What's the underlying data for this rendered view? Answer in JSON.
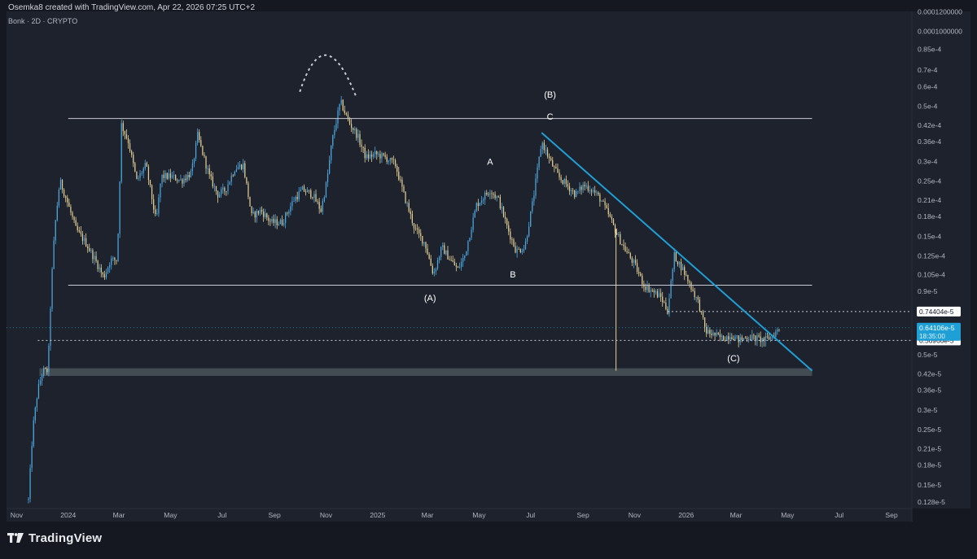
{
  "header": {
    "attribution": "Osemka8 created with TradingView.com, Apr 22, 2026 07:25 UTC+2",
    "symbol": "Bonk · 2D · CRYPTO"
  },
  "brand": {
    "name": "TradingView",
    "icon": "tradingview-logo-icon"
  },
  "colors": {
    "background": "#151821",
    "chart_bg": "#1e222d",
    "up": "#4da8e0",
    "down": "#e3cf94",
    "trendline": "#1e9fd6",
    "channel": "#c9ccd4",
    "zone": "#4a535a",
    "price_badge": "#1e9fd6"
  },
  "chart_data": {
    "type": "candlestick",
    "y_scale": "log",
    "ylim": [
      1.2e-06,
      0.00012
    ],
    "x_range": [
      "2023-10-20",
      "2026-09-25"
    ],
    "x_ticks": [
      {
        "date": "2023-11-01",
        "label": "Nov"
      },
      {
        "date": "2024-01-01",
        "label": "2024"
      },
      {
        "date": "2024-03-01",
        "label": "Mar"
      },
      {
        "date": "2024-05-01",
        "label": "May"
      },
      {
        "date": "2024-07-01",
        "label": "Jul"
      },
      {
        "date": "2024-09-01",
        "label": "Sep"
      },
      {
        "date": "2024-11-01",
        "label": "Nov"
      },
      {
        "date": "2025-01-01",
        "label": "2025"
      },
      {
        "date": "2025-03-01",
        "label": "Mar"
      },
      {
        "date": "2025-05-01",
        "label": "May"
      },
      {
        "date": "2025-07-01",
        "label": "Jul"
      },
      {
        "date": "2025-09-01",
        "label": "Sep"
      },
      {
        "date": "2025-11-01",
        "label": "Nov"
      },
      {
        "date": "2026-01-01",
        "label": "2026"
      },
      {
        "date": "2026-03-01",
        "label": "Mar"
      },
      {
        "date": "2026-05-01",
        "label": "May"
      },
      {
        "date": "2026-07-01",
        "label": "Jul"
      },
      {
        "date": "2026-09-01",
        "label": "Sep"
      }
    ],
    "y_ticks": [
      {
        "value": 0.00012,
        "label": "0.0001200000"
      },
      {
        "value": 0.0001,
        "label": "0.0001000000"
      },
      {
        "value": 8.5e-05,
        "label": "0.85e-4"
      },
      {
        "value": 7e-05,
        "label": "0.7e-4"
      },
      {
        "value": 6e-05,
        "label": "0.6e-4"
      },
      {
        "value": 5e-05,
        "label": "0.5e-4"
      },
      {
        "value": 4.2e-05,
        "label": "0.42e-4"
      },
      {
        "value": 3.6e-05,
        "label": "0.36e-4"
      },
      {
        "value": 3e-05,
        "label": "0.3e-4"
      },
      {
        "value": 2.5e-05,
        "label": "0.25e-4"
      },
      {
        "value": 2.1e-05,
        "label": "0.21e-4"
      },
      {
        "value": 1.8e-05,
        "label": "0.18e-4"
      },
      {
        "value": 1.5e-05,
        "label": "0.15e-4"
      },
      {
        "value": 1.25e-05,
        "label": "0.125e-4"
      },
      {
        "value": 1.05e-05,
        "label": "0.105e-4"
      },
      {
        "value": 9e-06,
        "label": "0.9e-5"
      },
      {
        "value": 5e-06,
        "label": "0.5e-5"
      },
      {
        "value": 4.2e-06,
        "label": "0.42e-5"
      },
      {
        "value": 3.6e-06,
        "label": "0.36e-5"
      },
      {
        "value": 3e-06,
        "label": "0.3e-5"
      },
      {
        "value": 2.5e-06,
        "label": "0.25e-5"
      },
      {
        "value": 2.1e-06,
        "label": "0.21e-5"
      },
      {
        "value": 1.8e-06,
        "label": "0.18e-5"
      },
      {
        "value": 1.5e-06,
        "label": "0.15e-5"
      },
      {
        "value": 1.28e-06,
        "label": "0.128e-5"
      }
    ],
    "price_path": [
      [
        "2023-11-15",
        1.3e-06
      ],
      [
        "2023-11-20",
        2.5e-06
      ],
      [
        "2023-11-26",
        3.6e-06
      ],
      [
        "2023-12-02",
        4.3e-06
      ],
      [
        "2023-12-08",
        4.3e-06
      ],
      [
        "2023-12-12",
        9.5e-06
      ],
      [
        "2023-12-16",
        1.6e-05
      ],
      [
        "2023-12-22",
        2.5e-05
      ],
      [
        "2023-12-30",
        2.1e-05
      ],
      [
        "2024-01-10",
        1.6e-05
      ],
      [
        "2024-01-22",
        1.4e-05
      ],
      [
        "2024-02-02",
        1.2e-05
      ],
      [
        "2024-02-12",
        1.02e-05
      ],
      [
        "2024-02-20",
        1.2e-05
      ],
      [
        "2024-02-28",
        1.2e-05
      ],
      [
        "2024-03-04",
        4.2e-05
      ],
      [
        "2024-03-12",
        3.6e-05
      ],
      [
        "2024-03-22",
        2.5e-05
      ],
      [
        "2024-04-02",
        2.9e-05
      ],
      [
        "2024-04-14",
        1.7e-05
      ],
      [
        "2024-04-20",
        2.6e-05
      ],
      [
        "2024-05-02",
        2.6e-05
      ],
      [
        "2024-05-14",
        2.5e-05
      ],
      [
        "2024-05-26",
        2.7e-05
      ],
      [
        "2024-06-02",
        3.8e-05
      ],
      [
        "2024-06-16",
        2.6e-05
      ],
      [
        "2024-06-26",
        2.2e-05
      ],
      [
        "2024-07-05",
        2.3e-05
      ],
      [
        "2024-07-16",
        2.8e-05
      ],
      [
        "2024-07-26",
        2.9e-05
      ],
      [
        "2024-08-05",
        1.8e-05
      ],
      [
        "2024-08-16",
        1.9e-05
      ],
      [
        "2024-08-28",
        1.7e-05
      ],
      [
        "2024-09-10",
        1.7e-05
      ],
      [
        "2024-09-24",
        2.1e-05
      ],
      [
        "2024-10-04",
        2.3e-05
      ],
      [
        "2024-10-16",
        2.2e-05
      ],
      [
        "2024-10-26",
        1.9e-05
      ],
      [
        "2024-11-02",
        2.5e-05
      ],
      [
        "2024-11-08",
        3.6e-05
      ],
      [
        "2024-11-18",
        5.2e-05
      ],
      [
        "2024-11-28",
        4.3e-05
      ],
      [
        "2024-12-08",
        3.8e-05
      ],
      [
        "2024-12-18",
        3.1e-05
      ],
      [
        "2024-12-30",
        3.2e-05
      ],
      [
        "2025-01-10",
        3.1e-05
      ],
      [
        "2025-01-22",
        2.9e-05
      ],
      [
        "2025-02-01",
        2.2e-05
      ],
      [
        "2025-02-14",
        1.6e-05
      ],
      [
        "2025-02-26",
        1.4e-05
      ],
      [
        "2025-03-08",
        1.05e-05
      ],
      [
        "2025-03-18",
        1.35e-05
      ],
      [
        "2025-03-28",
        1.2e-05
      ],
      [
        "2025-04-06",
        1.1e-05
      ],
      [
        "2025-04-14",
        1.25e-05
      ],
      [
        "2025-04-28",
        2e-05
      ],
      [
        "2025-05-14",
        2.3e-05
      ],
      [
        "2025-05-24",
        2.1e-05
      ],
      [
        "2025-06-04",
        1.6e-05
      ],
      [
        "2025-06-14",
        1.3e-05
      ],
      [
        "2025-06-24",
        1.35e-05
      ],
      [
        "2025-07-04",
        2.1e-05
      ],
      [
        "2025-07-14",
        3.6e-05
      ],
      [
        "2025-07-24",
        3e-05
      ],
      [
        "2025-08-03",
        2.6e-05
      ],
      [
        "2025-08-13",
        2.4e-05
      ],
      [
        "2025-08-23",
        2.2e-05
      ],
      [
        "2025-09-02",
        2.4e-05
      ],
      [
        "2025-09-12",
        2.3e-05
      ],
      [
        "2025-09-22",
        2.1e-05
      ],
      [
        "2025-10-02",
        1.8e-05
      ],
      [
        "2025-10-12",
        1.5e-05
      ],
      [
        "2025-10-22",
        1.3e-05
      ],
      [
        "2025-11-01",
        1.15e-05
      ],
      [
        "2025-11-12",
        9.5e-06
      ],
      [
        "2025-11-22",
        9e-06
      ],
      [
        "2025-12-02",
        8.5e-06
      ],
      [
        "2025-12-10",
        7.5e-06
      ],
      [
        "2025-12-18",
        1.25e-05
      ],
      [
        "2025-12-28",
        1.1e-05
      ],
      [
        "2026-01-06",
        9.5e-06
      ],
      [
        "2026-01-16",
        8e-06
      ],
      [
        "2026-01-24",
        6.2e-06
      ],
      [
        "2026-02-03",
        6e-06
      ],
      [
        "2026-02-13",
        5.8e-06
      ],
      [
        "2026-02-23",
        6e-06
      ],
      [
        "2026-03-05",
        5.7e-06
      ],
      [
        "2026-03-15",
        5.9e-06
      ],
      [
        "2026-03-25",
        5.8e-06
      ],
      [
        "2026-04-04",
        5.7e-06
      ],
      [
        "2026-04-12",
        5.9e-06
      ],
      [
        "2026-04-22",
        6.4e-06
      ]
    ],
    "price_line": {
      "value": 6.41e-06,
      "label": "0.64106e-5",
      "countdown": "18:35:00"
    },
    "levels": [
      {
        "value": 7.4404e-06,
        "label": "0.74404e-5",
        "start": "2025-12-10"
      },
      {
        "value": 5.6966e-06,
        "label": "0.56966e-5",
        "start": "2023-11-26"
      }
    ],
    "channel": {
      "upper": {
        "value": 4.45e-05,
        "from": "2024-01-01",
        "to": "2026-05-30"
      },
      "lower": {
        "value": 9.5e-06,
        "from": "2024-01-01",
        "to": "2026-05-30"
      }
    },
    "support_zone": {
      "low": 4.1e-06,
      "high": 4.4e-06,
      "from": "2023-11-28",
      "to": "2026-05-30"
    },
    "trendline": {
      "from": [
        "2025-07-14",
        3.9e-05
      ],
      "to": [
        "2026-05-30",
        4.3e-06
      ]
    },
    "spike": {
      "date": "2025-10-10",
      "low": 4.3e-06,
      "high": 1.6e-05
    },
    "arc": {
      "from": [
        "2024-10-01",
        5.7e-05
      ],
      "top": [
        "2024-11-01",
        8e-05
      ],
      "to": [
        "2024-12-06",
        5.5e-05
      ]
    },
    "annotations": [
      {
        "text": "(B)",
        "date": "2025-07-24",
        "value": 5.4e-05
      },
      {
        "text": "C",
        "date": "2025-07-24",
        "value": 4.4e-05
      },
      {
        "text": "A",
        "date": "2025-05-14",
        "value": 2.9e-05
      },
      {
        "text": "B",
        "date": "2025-06-10",
        "value": 1.02e-05
      },
      {
        "text": "(A)",
        "date": "2025-03-04",
        "value": 8.2e-06
      },
      {
        "text": "(C)",
        "date": "2026-02-26",
        "value": 4.7e-06
      }
    ]
  }
}
